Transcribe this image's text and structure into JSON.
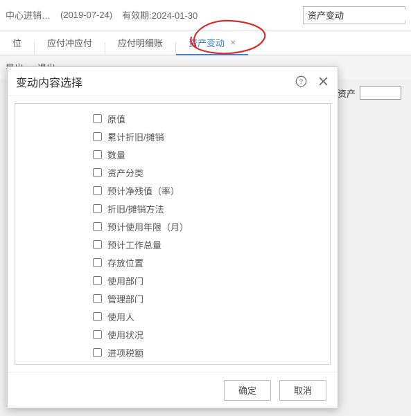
{
  "header": {
    "title_part1": "中心进销…",
    "date_paren": "(2019-07-24)",
    "valid_label": "有效期:2024-01-30"
  },
  "search": {
    "value": "资产变动"
  },
  "tabs": [
    {
      "label": "位"
    },
    {
      "label": "应付冲应付"
    },
    {
      "label": "应付明细账"
    },
    {
      "label": "资产变动",
      "active": true,
      "closable": true
    }
  ],
  "toolbar": {
    "export": "导出",
    "exit": "退出"
  },
  "form": {
    "asset_label": "资产"
  },
  "modal": {
    "title": "变动内容选择",
    "items": [
      "原值",
      "累计折旧/摊销",
      "数量",
      "资产分类",
      "预计净残值（率）",
      "折旧/摊销方法",
      "预计使用年限（月）",
      "预计工作总量",
      "存放位置",
      "使用部门",
      "管理部门",
      "使用人",
      "使用状况",
      "进项税额"
    ],
    "ok": "确定",
    "cancel": "取消"
  }
}
